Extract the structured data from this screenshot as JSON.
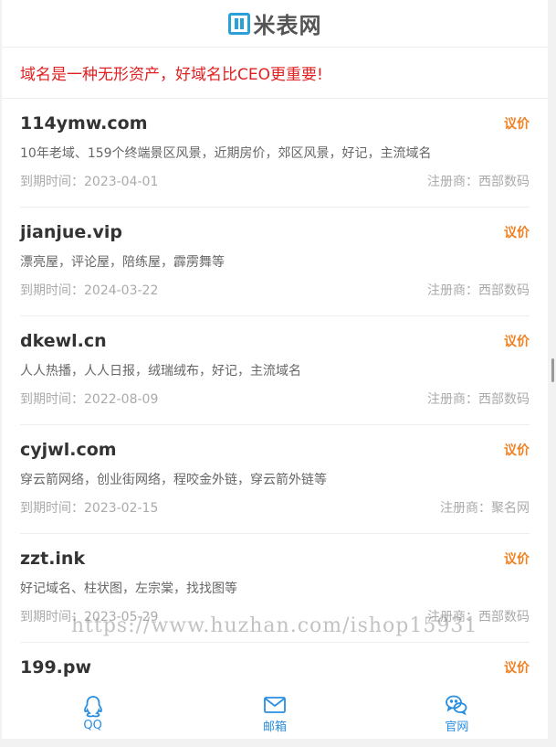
{
  "header": {
    "logo_text": "米表网"
  },
  "slogan": "域名是一种无形资产，好域名比CEO更重要!",
  "labels": {
    "expire_prefix": "到期时间：",
    "registrar_prefix": "注册商："
  },
  "items": [
    {
      "domain": "114ymw.com",
      "price": "议价",
      "desc": "10年老域、159个终端景区风景，近期房价，郊区风景，好记，主流域名",
      "expire": "到期时间：2023-04-01",
      "registrar": "注册商：西部数码"
    },
    {
      "domain": "jianjue.vip",
      "price": "议价",
      "desc": "漂亮屋，评论屋，陪练屋，霹雳舞等",
      "expire": "到期时间：2024-03-22",
      "registrar": "注册商：西部数码"
    },
    {
      "domain": "dkewl.cn",
      "price": "议价",
      "desc": "人人热播，人人日报，绒瑞绒布，好记，主流域名",
      "expire": "到期时间：2022-08-09",
      "registrar": "注册商：西部数码"
    },
    {
      "domain": "cyjwl.com",
      "price": "议价",
      "desc": "穿云箭网络，创业街网络，程咬金外链，穿云箭外链等",
      "expire": "到期时间：2023-02-15",
      "registrar": "注册商：聚名网"
    },
    {
      "domain": "zzt.ink",
      "price": "议价",
      "desc": "好记域名、柱状图，左宗棠，找找图等",
      "expire": "到期时间：2023-05-29",
      "registrar": "注册商：西部数码"
    },
    {
      "domain": "199.pw",
      "price": "议价",
      "desc": "",
      "expire": "",
      "registrar": ""
    }
  ],
  "nav": {
    "qq": "QQ",
    "mail": "邮箱",
    "site": "官网"
  },
  "watermark": "https://www.huzhan.com/ishop15931",
  "colors": {
    "accent": "#2a8ee0",
    "price": "#f08020",
    "slogan": "#e02020"
  }
}
